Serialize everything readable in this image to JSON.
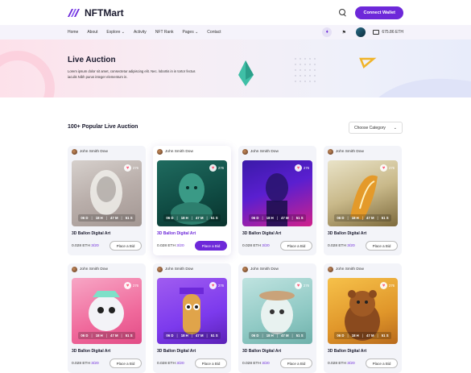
{
  "brand": {
    "name": "NFTMart"
  },
  "header": {
    "connect_label": "Connect Wallet"
  },
  "nav": {
    "links": [
      "Home",
      "About",
      "Explore",
      "Activity",
      "NFT Rank",
      "Pages",
      "Contact"
    ],
    "wallet_balance": "675.86 ETH"
  },
  "hero": {
    "title": "Live Auction",
    "subtitle": "Lorem ipsum dolor sit amet, consectetur adipiscing elit. Nec. lobortis in in tortor fectus iaculis Nibh purus integer elementum in."
  },
  "section": {
    "title": "100+ Popular Live Auction",
    "category_label": "Choose Category"
  },
  "cards": [
    {
      "author": "John Smith Dow",
      "likes": "276",
      "timer": [
        "06 D",
        "18 H",
        "47 M",
        "51 S"
      ],
      "title": "3D Ballon Digital Art",
      "price": "0.028 ETH",
      "count": "3/20",
      "bid": "Place a Bid"
    },
    {
      "author": "John Smith Dow",
      "likes": "276",
      "timer": [
        "06 D",
        "18 H",
        "47 M",
        "51 S"
      ],
      "title": "3D Ballon Digital Art",
      "price": "0.028 ETH",
      "count": "3/20",
      "bid": "Place a Bid"
    },
    {
      "author": "John Smith Dow",
      "likes": "276",
      "timer": [
        "06 D",
        "18 H",
        "47 M",
        "51 S"
      ],
      "title": "3D Ballon Digital Art",
      "price": "0.028 ETH",
      "count": "3/20",
      "bid": "Place a Bid"
    },
    {
      "author": "John Smith Dow",
      "likes": "276",
      "timer": [
        "06 D",
        "18 H",
        "47 M",
        "51 S"
      ],
      "title": "3D Ballon Digital Art",
      "price": "0.028 ETH",
      "count": "3/20",
      "bid": "Place a Bid"
    },
    {
      "author": "John Smith Dow",
      "likes": "276",
      "timer": [
        "06 D",
        "18 H",
        "47 M",
        "51 S"
      ],
      "title": "3D Ballon Digital Art",
      "price": "0.028 ETH",
      "count": "3/20",
      "bid": "Place a Bid"
    },
    {
      "author": "John Smith Dow",
      "likes": "276",
      "timer": [
        "06 D",
        "18 H",
        "47 M",
        "51 S"
      ],
      "title": "3D Ballon Digital Art",
      "price": "0.028 ETH",
      "count": "3/20",
      "bid": "Place a Bid"
    },
    {
      "author": "John Smith Dow",
      "likes": "276",
      "timer": [
        "06 D",
        "18 H",
        "47 M",
        "51 S"
      ],
      "title": "3D Ballon Digital Art",
      "price": "0.028 ETH",
      "count": "3/20",
      "bid": "Place a Bid"
    },
    {
      "author": "John Smith Dow",
      "likes": "276",
      "timer": [
        "06 D",
        "18 H",
        "47 M",
        "51 S"
      ],
      "title": "3D Ballon Digital Art",
      "price": "0.028 ETH",
      "count": "3/20",
      "bid": "Place a Bid"
    }
  ],
  "colors": {
    "accent": "#6d28d9"
  }
}
